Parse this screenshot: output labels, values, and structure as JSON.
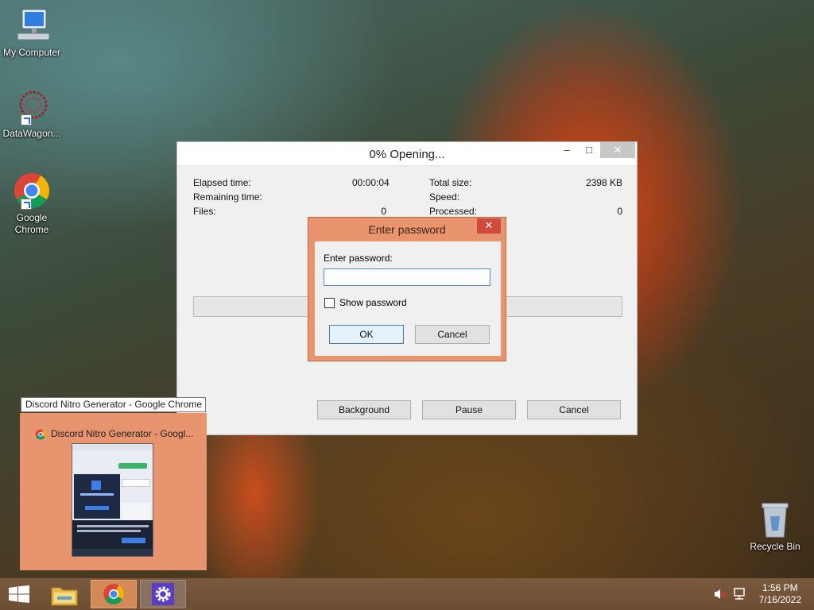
{
  "desktop": {
    "icons": [
      {
        "label": "My Computer"
      },
      {
        "label": "DataWagon..."
      },
      {
        "label": "Google Chrome"
      },
      {
        "label": "Recycle Bin"
      }
    ]
  },
  "progress_window": {
    "title": "0% Opening...",
    "stats_left": [
      {
        "label": "Elapsed time:",
        "value": "00:00:04"
      },
      {
        "label": "Remaining time:",
        "value": ""
      },
      {
        "label": "Files:",
        "value": "0"
      }
    ],
    "stats_right": [
      {
        "label": "Total size:",
        "value": "2398 KB"
      },
      {
        "label": "Speed:",
        "value": ""
      },
      {
        "label": "Processed:",
        "value": "0"
      }
    ],
    "progress": 0,
    "buttons": {
      "background": "Background",
      "pause": "Pause",
      "cancel": "Cancel"
    }
  },
  "password_dialog": {
    "title": "Enter password",
    "prompt": "Enter password:",
    "input_value": "",
    "show_password_label": "Show password",
    "show_password_checked": false,
    "ok_label": "OK",
    "cancel_label": "Cancel"
  },
  "taskbar_preview": {
    "tooltip": "Discord Nitro Generator - Google Chrome",
    "title": "Discord Nitro Generator - Googl..."
  },
  "taskbar": {
    "time": "1:56 PM",
    "date": "7/16/2022"
  },
  "colors": {
    "accent": "#e8946e",
    "chrome_task_active": "#d48a57"
  }
}
